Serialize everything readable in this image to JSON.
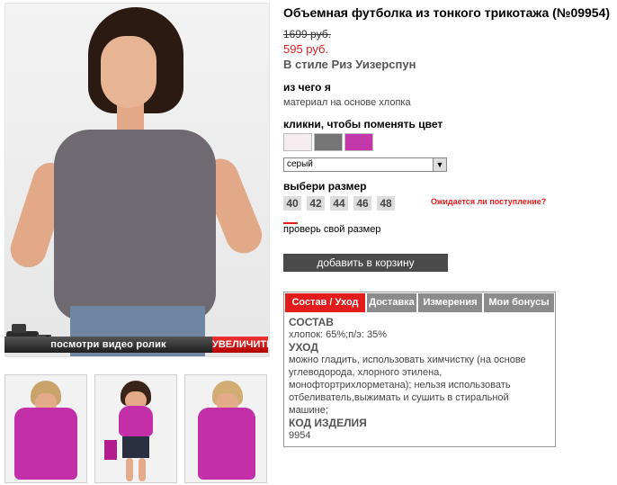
{
  "product": {
    "title": "Объемная футболка из тонкого трикотажа (№09954)",
    "old_price": "1699 руб.",
    "new_price": "595 руб.",
    "brand": "В стиле Риз Уизерспун"
  },
  "material": {
    "heading": "из чего я",
    "text": "материал на основе хлопка"
  },
  "color": {
    "heading": "кликни, чтобы поменять цвет",
    "swatches": [
      "#f4ecef",
      "#757575",
      "#c238ab"
    ],
    "selected": "серый"
  },
  "size": {
    "heading": "выбери размер",
    "options": [
      "40",
      "42",
      "44",
      "46",
      "48"
    ],
    "awaited_link": "Ожидается ли поступление?",
    "check_link": "проверь свой размер"
  },
  "cart": {
    "button_label": "добавить в корзину"
  },
  "media": {
    "video_label": "посмотри видео ролик",
    "enlarge_label": "УВЕЛИЧИТЬ"
  },
  "tabs": [
    {
      "label": "Состав / Уход"
    },
    {
      "label": "Доставка"
    },
    {
      "label": "Измерения"
    },
    {
      "label": "Мои бонусы"
    }
  ],
  "details": {
    "composition_heading": "СОСТАВ",
    "composition": "хлопок: 65%;п/э: 35%",
    "care_heading": "УХОД",
    "care": "можно гладить, использовать химчистку (на основе углеводорода, хлорного этилена, монофтортрихлорметана); нельзя использовать отбеливатель,выжимать и сушить в стиральной машине;",
    "code_heading": "КОД ИЗДЕЛИЯ",
    "code": "9954"
  },
  "colors": {
    "accent": "#e41b1b",
    "button": "#4a4a4a",
    "tab_inactive": "#8b8b8b"
  }
}
